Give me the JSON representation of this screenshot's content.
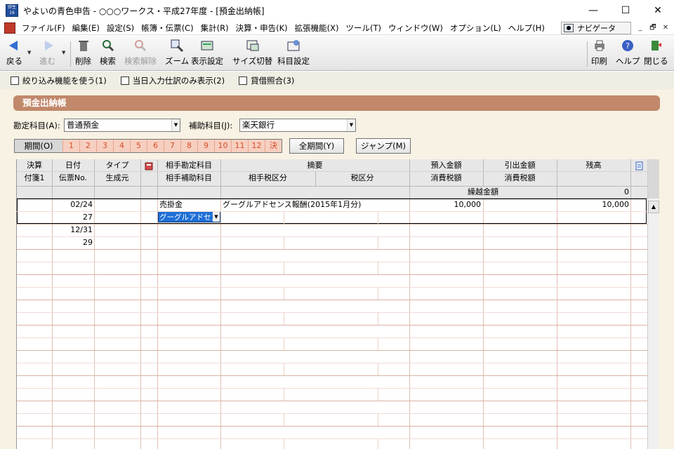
{
  "window": {
    "icon_text": "弥生16",
    "title": "やよいの青色申告 - ○○○ワークス・平成27年度 - [預金出納帳]",
    "minimize": "—",
    "maximize": "☐",
    "close": "✕"
  },
  "menu": {
    "items": [
      "ファイル(F)",
      "編集(E)",
      "設定(S)",
      "帳簿・伝票(C)",
      "集計(R)",
      "決算・申告(K)",
      "拡張機能(X)",
      "ツール(T)",
      "ウィンドウ(W)",
      "オプション(L)",
      "ヘルプ(H)"
    ],
    "navigator": "ナビゲータ",
    "mdi_min": "_",
    "mdi_restore": "🗗",
    "mdi_close": "✕"
  },
  "toolbar": {
    "back": "戻る",
    "forward": "進む",
    "delete": "削除",
    "search": "検索",
    "clear_search": "検索解除",
    "zoom": "ズーム",
    "display_settings": "表示設定",
    "size_switch": "サイズ切替",
    "account_settings": "科目設定",
    "print": "印刷",
    "help": "ヘルプ",
    "close": "閉じる"
  },
  "filters": {
    "narrow": "絞り込み機能を使う(1)",
    "today_only": "当日入力仕訳のみ表示(2)",
    "debit_credit_check": "貸借照合(3)"
  },
  "ledger": {
    "title": "預金出納帳",
    "account_label": "勘定科目(A):",
    "account_value": "普通預金",
    "sub_account_label": "補助科目(J):",
    "sub_account_value": "楽天銀行",
    "period_label": "期間(O)",
    "periods": [
      "1",
      "2",
      "3",
      "4",
      "5",
      "6",
      "7",
      "8",
      "9",
      "10",
      "11",
      "12",
      "決"
    ],
    "all_period_button": "全期間(Y)",
    "jump_button": "ジャンプ(M)"
  },
  "grid": {
    "headers": {
      "settle": "決算",
      "tag1": "付箋1",
      "date": "日付",
      "slip_no": "伝票No.",
      "type": "タイプ",
      "source": "生成元",
      "counter_account": "相手勘定科目",
      "counter_sub": "相手補助科目",
      "summary": "摘要",
      "counter_tax": "相手税区分",
      "tax": "税区分",
      "deposit": "預入金額",
      "deposit_tax": "消費税額",
      "withdraw": "引出金額",
      "withdraw_tax": "消費税額",
      "balance": "残高",
      "carry_label": "繰越金額",
      "carry_value": "0"
    },
    "rows": [
      {
        "date": "02/24",
        "slip": "27",
        "account": "売掛金",
        "sub": "グーグルアドセン",
        "summary": "グーグルアドセンス報酬(2015年1月分)",
        "deposit": "10,000",
        "balance": "10,000"
      },
      {
        "date": "12/31",
        "slip": "29"
      }
    ]
  },
  "colors": {
    "section_header": "#c1886b",
    "content_bg": "#f7f2e3",
    "period_cells": "#f6cfc0",
    "selection": "#1e6fd6"
  }
}
